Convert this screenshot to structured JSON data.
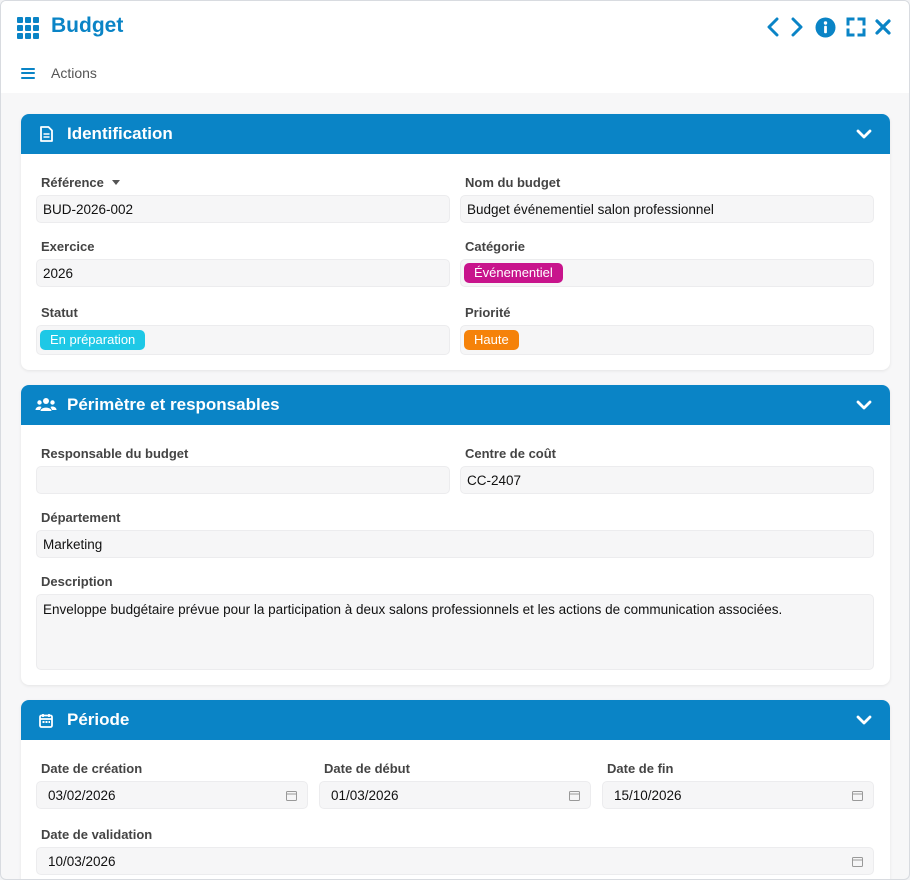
{
  "window": {
    "title": "Budget"
  },
  "toolbar": {
    "actions_label": "Actions"
  },
  "sections": {
    "identification": {
      "title": "Identification",
      "reference": {
        "label": "Référence",
        "value": "BUD-2026-002"
      },
      "nom": {
        "label": "Nom du budget",
        "value": "Budget événementiel salon professionnel"
      },
      "exercice": {
        "label": "Exercice",
        "value": "2026"
      },
      "categorie": {
        "label": "Catégorie",
        "value": "Événementiel",
        "color": "#c8148c"
      },
      "statut": {
        "label": "Statut",
        "value": "En préparation",
        "color": "#1ec8e6"
      },
      "priorite": {
        "label": "Priorité",
        "value": "Haute",
        "color": "#f5820a"
      }
    },
    "perimetre": {
      "title": "Périmètre et responsables",
      "responsable": {
        "label": "Responsable du budget",
        "value": ""
      },
      "centre": {
        "label": "Centre de coût",
        "value": "CC-2407"
      },
      "departement": {
        "label": "Département",
        "value": "Marketing"
      },
      "description": {
        "label": "Description",
        "value": "Enveloppe budgétaire prévue pour la participation à deux salons professionnels et les actions de communication associées."
      }
    },
    "periode": {
      "title": "Période",
      "creation": {
        "label": "Date de création",
        "value": "03/02/2026"
      },
      "debut": {
        "label": "Date de début",
        "value": "01/03/2026"
      },
      "fin": {
        "label": "Date de fin",
        "value": "15/10/2026"
      },
      "validation": {
        "label": "Date de validation",
        "value": "10/03/2026"
      }
    }
  },
  "colors": {
    "accent": "#0a84c6"
  },
  "icons": {
    "app": "grid-icon",
    "prev": "chevron-left-icon",
    "next": "chevron-right-icon",
    "info": "info-icon",
    "fullscreen": "expand-icon",
    "close": "close-icon",
    "menu": "hamburger-icon",
    "identification": "document-icon",
    "perimetre": "users-icon",
    "periode": "calendar-icon",
    "collapse": "chevron-down-icon",
    "date": "calendar-icon"
  }
}
